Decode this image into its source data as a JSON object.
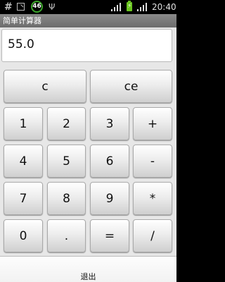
{
  "status_bar": {
    "hash_glyph": "#",
    "badge_count": "46",
    "usb_glyph": "Ψ",
    "time": "20:40"
  },
  "title_bar": {
    "title": "简单计算器"
  },
  "display": {
    "value": "55.0"
  },
  "keys": {
    "clear": "c",
    "clear_entry": "ce",
    "k1": "1",
    "k2": "2",
    "k3": "3",
    "plus": "+",
    "k4": "4",
    "k5": "5",
    "k6": "6",
    "minus": "-",
    "k7": "7",
    "k8": "8",
    "k9": "9",
    "multiply": "*",
    "k0": "0",
    "dot": ".",
    "equals": "=",
    "divide": "/"
  },
  "exit_button": {
    "label": "退出"
  }
}
